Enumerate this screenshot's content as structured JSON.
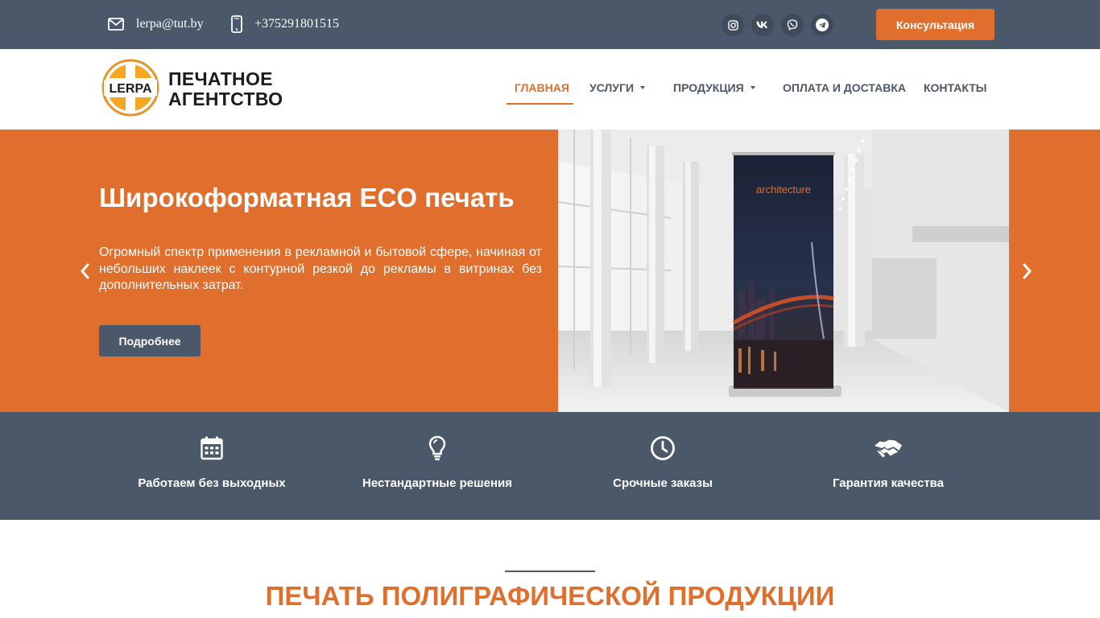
{
  "topbar": {
    "email": "lerpa@tut.by",
    "phone": "+375291801515",
    "socials": [
      "instagram-icon",
      "vk-icon",
      "viber-icon",
      "telegram-icon"
    ],
    "consult_label": "Консультация"
  },
  "header": {
    "logo_mark": "LERPA",
    "logo_line1": "ПЕЧАТНОЕ",
    "logo_line2": "АГЕНТСТВО",
    "nav": [
      {
        "label": "ГЛАВНАЯ",
        "active": true
      },
      {
        "label": "УСЛУГИ",
        "dropdown": true
      },
      {
        "label": "ПРОДУКЦИЯ",
        "dropdown": true
      },
      {
        "label": "ОПЛАТА И ДОСТАВКА"
      },
      {
        "label": "КОНТАКТЫ"
      }
    ]
  },
  "hero": {
    "title": "Широкоформатная ECO печать",
    "text": "Огромный спектр применения в рекламной и бытовой сфере, начиная от небольших наклеек с контурной резкой до рекламы в витринах без дополнительных затрат.",
    "button": "Подробнее",
    "banner_word": "architecture"
  },
  "features": [
    {
      "icon": "calendar-icon",
      "label": "Работаем без выходных"
    },
    {
      "icon": "lightbulb-icon",
      "label": "Нестандартные решения"
    },
    {
      "icon": "clock-icon",
      "label": "Срочные заказы"
    },
    {
      "icon": "handshake-icon",
      "label": "Гарантия качества"
    }
  ],
  "section": {
    "title": "ПЕЧАТЬ ПОЛИГРАФИЧЕСКОЙ ПРОДУКЦИИ"
  },
  "colors": {
    "accent": "#e06e2d",
    "dark": "#4b586a"
  }
}
